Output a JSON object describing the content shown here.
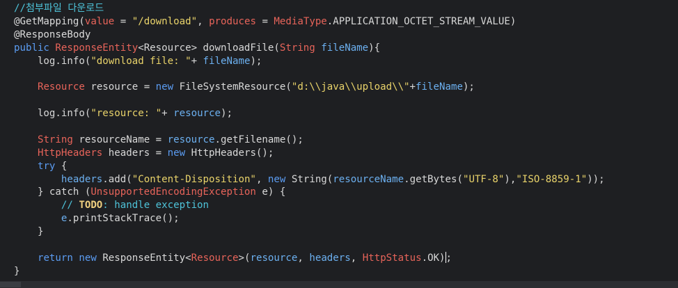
{
  "editor": {
    "language": "java",
    "caret_line": 19,
    "lines": [
      [
        {
          "t": "comment",
          "v": "//첨부파일 다운로드"
        }
      ],
      [
        {
          "t": "ann",
          "v": "@GetMapping("
        },
        {
          "t": "param",
          "v": "value"
        },
        {
          "t": "plain",
          "v": " = "
        },
        {
          "t": "str",
          "v": "\"/download\""
        },
        {
          "t": "plain",
          "v": ", "
        },
        {
          "t": "param",
          "v": "produces"
        },
        {
          "t": "plain",
          "v": " = "
        },
        {
          "t": "type",
          "v": "MediaType"
        },
        {
          "t": "plain",
          "v": ".APPLICATION_OCTET_STREAM_VALUE)"
        }
      ],
      [
        {
          "t": "ann",
          "v": "@ResponseBody"
        }
      ],
      [
        {
          "t": "kw",
          "v": "public "
        },
        {
          "t": "type",
          "v": "ResponseEntity"
        },
        {
          "t": "plain",
          "v": "<Resource> downloadFile("
        },
        {
          "t": "type",
          "v": "String "
        },
        {
          "t": "var",
          "v": "fileName"
        },
        {
          "t": "plain",
          "v": "){"
        }
      ],
      [
        {
          "t": "plain",
          "v": "    log.info("
        },
        {
          "t": "str",
          "v": "\"download file: \""
        },
        {
          "t": "plain",
          "v": "+ "
        },
        {
          "t": "var",
          "v": "fileName"
        },
        {
          "t": "plain",
          "v": ");"
        }
      ],
      [],
      [
        {
          "t": "plain",
          "v": "    "
        },
        {
          "t": "type",
          "v": "Resource"
        },
        {
          "t": "plain",
          "v": " resource = "
        },
        {
          "t": "kw",
          "v": "new "
        },
        {
          "t": "plain",
          "v": "FileSystemResource("
        },
        {
          "t": "str",
          "v": "\"d:\\\\java\\\\upload\\\\\""
        },
        {
          "t": "plain",
          "v": "+"
        },
        {
          "t": "var",
          "v": "fileName"
        },
        {
          "t": "plain",
          "v": ");"
        }
      ],
      [],
      [
        {
          "t": "plain",
          "v": "    log.info("
        },
        {
          "t": "str",
          "v": "\"resource: \""
        },
        {
          "t": "plain",
          "v": "+ "
        },
        {
          "t": "var",
          "v": "resource"
        },
        {
          "t": "plain",
          "v": ");"
        }
      ],
      [],
      [
        {
          "t": "plain",
          "v": "    "
        },
        {
          "t": "type",
          "v": "String"
        },
        {
          "t": "plain",
          "v": " resourceName = "
        },
        {
          "t": "var",
          "v": "resource"
        },
        {
          "t": "plain",
          "v": ".getFilename();"
        }
      ],
      [
        {
          "t": "plain",
          "v": "    "
        },
        {
          "t": "type",
          "v": "HttpHeaders"
        },
        {
          "t": "plain",
          "v": " headers = "
        },
        {
          "t": "kw",
          "v": "new "
        },
        {
          "t": "plain",
          "v": "HttpHeaders();"
        }
      ],
      [
        {
          "t": "plain",
          "v": "    "
        },
        {
          "t": "kw",
          "v": "try"
        },
        {
          "t": "plain",
          "v": " {"
        }
      ],
      [
        {
          "t": "plain",
          "v": "        "
        },
        {
          "t": "var",
          "v": "headers"
        },
        {
          "t": "plain",
          "v": ".add("
        },
        {
          "t": "str",
          "v": "\"Content-Disposition\""
        },
        {
          "t": "plain",
          "v": ", "
        },
        {
          "t": "kw",
          "v": "new "
        },
        {
          "t": "plain",
          "v": "String("
        },
        {
          "t": "var",
          "v": "resourceName"
        },
        {
          "t": "plain",
          "v": ".getBytes("
        },
        {
          "t": "str",
          "v": "\"UTF-8\""
        },
        {
          "t": "plain",
          "v": "),"
        },
        {
          "t": "str",
          "v": "\"ISO-8859-1\""
        },
        {
          "t": "plain",
          "v": "));"
        }
      ],
      [
        {
          "t": "plain",
          "v": "    } catch ("
        },
        {
          "t": "type",
          "v": "UnsupportedEncodingException"
        },
        {
          "t": "plain",
          "v": " e) {"
        }
      ],
      [
        {
          "t": "comment",
          "v": "        // "
        },
        {
          "t": "todo",
          "v": "TODO"
        },
        {
          "t": "comment",
          "v": ": handle exception"
        }
      ],
      [
        {
          "t": "plain",
          "v": "        "
        },
        {
          "t": "var",
          "v": "e"
        },
        {
          "t": "plain",
          "v": ".printStackTrace();"
        }
      ],
      [
        {
          "t": "plain",
          "v": "    }"
        }
      ],
      [],
      [
        {
          "t": "plain",
          "v": "    "
        },
        {
          "t": "kw",
          "v": "return "
        },
        {
          "t": "kw",
          "v": "new "
        },
        {
          "t": "plain",
          "v": "ResponseEntity<"
        },
        {
          "t": "type",
          "v": "Resource"
        },
        {
          "t": "plain",
          "v": ">("
        },
        {
          "t": "var",
          "v": "resource"
        },
        {
          "t": "plain",
          "v": ", "
        },
        {
          "t": "var",
          "v": "headers"
        },
        {
          "t": "plain",
          "v": ", "
        },
        {
          "t": "type",
          "v": "HttpStatus"
        },
        {
          "t": "plain",
          "v": ".OK)"
        },
        {
          "t": "caret",
          "v": ""
        },
        {
          "t": "plain",
          "v": ";"
        }
      ],
      [
        {
          "t": "plain",
          "v": "}"
        }
      ]
    ]
  },
  "colors": {
    "background": "#1e1f22",
    "keyword": "#5b9cf2",
    "string": "#e9d36a",
    "type": "#e8645a",
    "variable": "#6cb0f0",
    "comment": "#4ec3d9",
    "text": "#d8d8d8"
  }
}
